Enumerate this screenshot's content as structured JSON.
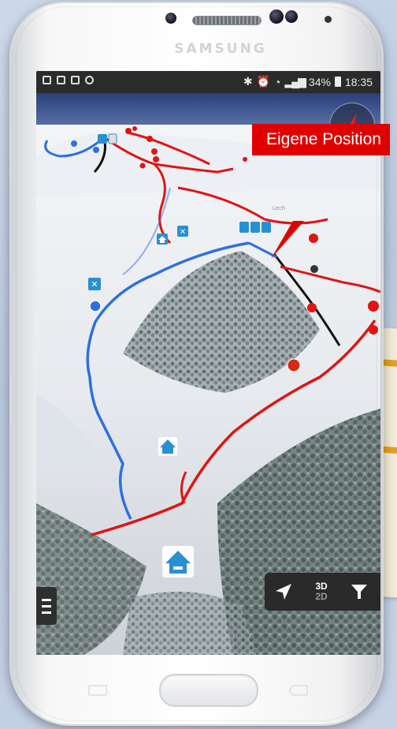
{
  "device": {
    "brand": "SAMSUNG"
  },
  "status_bar": {
    "battery": "34%",
    "time": "18:35"
  },
  "map": {
    "callout_label": "Eigene Position",
    "place_label": "Lech"
  },
  "toolbar": {
    "mode_3d": "3D",
    "mode_2d": "2D"
  },
  "colors": {
    "slope_red": "#e01414",
    "slope_blue": "#2f6fe0",
    "slope_black": "#111111",
    "callout": "#e00000",
    "hut_icon": "#2a8fd0"
  }
}
